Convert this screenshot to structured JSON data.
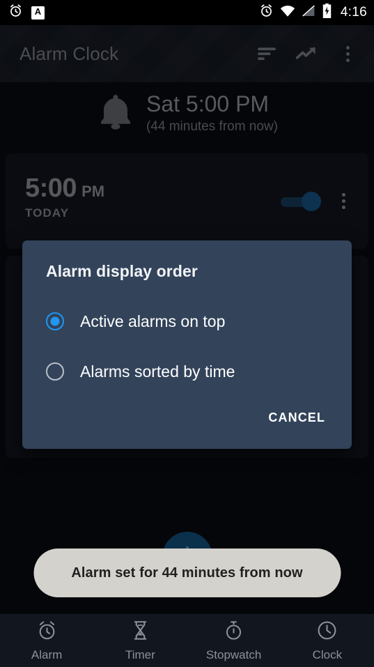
{
  "status_bar": {
    "left_icons": [
      "alarm-icon",
      "a-badge-icon"
    ],
    "a_badge_text": "A",
    "right_icons": [
      "alarm-icon",
      "wifi-icon",
      "signal-off-icon",
      "battery-charging-icon"
    ],
    "time": "4:16"
  },
  "toolbar": {
    "title": "Alarm Clock",
    "actions": [
      {
        "name": "sort-icon",
        "label": "Sort"
      },
      {
        "name": "trending-up-icon",
        "label": "Trends"
      },
      {
        "name": "overflow-menu-icon",
        "label": "More options"
      }
    ]
  },
  "next_alarm": {
    "icon": "bell-icon",
    "time": "Sat 5:00 PM",
    "relative": "(44 minutes from now)"
  },
  "alarms": [
    {
      "hour": "5:00",
      "ampm": "PM",
      "day": "TODAY",
      "enabled": true,
      "toggle_state": "on",
      "overflow_icon": "overflow-menu-icon"
    }
  ],
  "fab": {
    "icon": "plus-icon",
    "label": "Add alarm"
  },
  "dialog": {
    "title": "Alarm display order",
    "options": [
      {
        "label": "Active alarms on top",
        "selected": true
      },
      {
        "label": "Alarms sorted by time",
        "selected": false
      }
    ],
    "cancel_label": "CANCEL"
  },
  "toast": {
    "text": "Alarm set for 44 minutes from now"
  },
  "bottom_nav": {
    "items": [
      {
        "label": "Alarm",
        "icon": "alarm-clock-icon",
        "selected": true
      },
      {
        "label": "Timer",
        "icon": "hourglass-icon",
        "selected": false
      },
      {
        "label": "Stopwatch",
        "icon": "stopwatch-icon",
        "selected": false
      },
      {
        "label": "Clock",
        "icon": "clock-icon",
        "selected": false
      }
    ]
  },
  "colors": {
    "accent_blue": "#2196f3",
    "toggle_blue": "#1b6aa5",
    "dialog_bg": "#32435a",
    "app_bg": "#0b0e13",
    "card_bg": "#161b26",
    "toast_bg": "#d4d2cd",
    "toolbar_bg": "#1b2029"
  }
}
